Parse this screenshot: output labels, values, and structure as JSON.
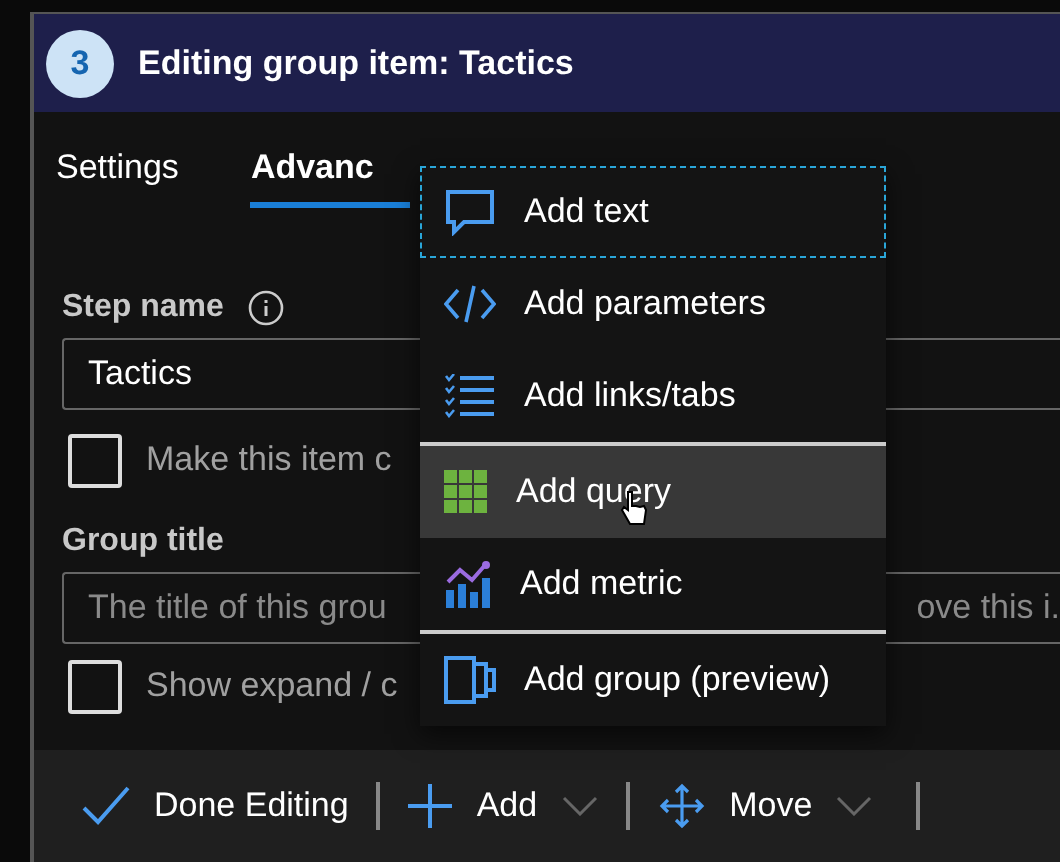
{
  "header": {
    "step": "3",
    "title": "Editing group item: Tactics"
  },
  "tabs": [
    {
      "label": "Settings",
      "selected": false
    },
    {
      "label": "Advanc",
      "selected": true
    }
  ],
  "step_name": {
    "label": "Step name",
    "value": "Tactics"
  },
  "make_item_checkbox": {
    "label": "Make this item c",
    "checked": false
  },
  "group_title": {
    "label": "Group title",
    "placeholder_parts": [
      "The title of this grou",
      "ove this i."
    ]
  },
  "show_expand_checkbox": {
    "label": "Show expand / c",
    "checked": false
  },
  "add_menu": [
    {
      "kind": "text",
      "label": "Add text",
      "focused": true,
      "hovered": false
    },
    {
      "kind": "parameters",
      "label": "Add parameters",
      "focused": false,
      "hovered": false
    },
    {
      "kind": "links",
      "label": "Add links/tabs",
      "focused": false,
      "hovered": false
    },
    {
      "kind": "query",
      "label": "Add query",
      "focused": false,
      "hovered": true
    },
    {
      "kind": "metric",
      "label": "Add metric",
      "focused": false,
      "hovered": false
    },
    {
      "kind": "group",
      "label": "Add group (preview)",
      "focused": false,
      "hovered": false
    }
  ],
  "toolbar": [
    {
      "kind": "done",
      "label": "Done Editing"
    },
    {
      "kind": "add",
      "label": "Add"
    },
    {
      "kind": "move",
      "label": "Move"
    }
  ]
}
